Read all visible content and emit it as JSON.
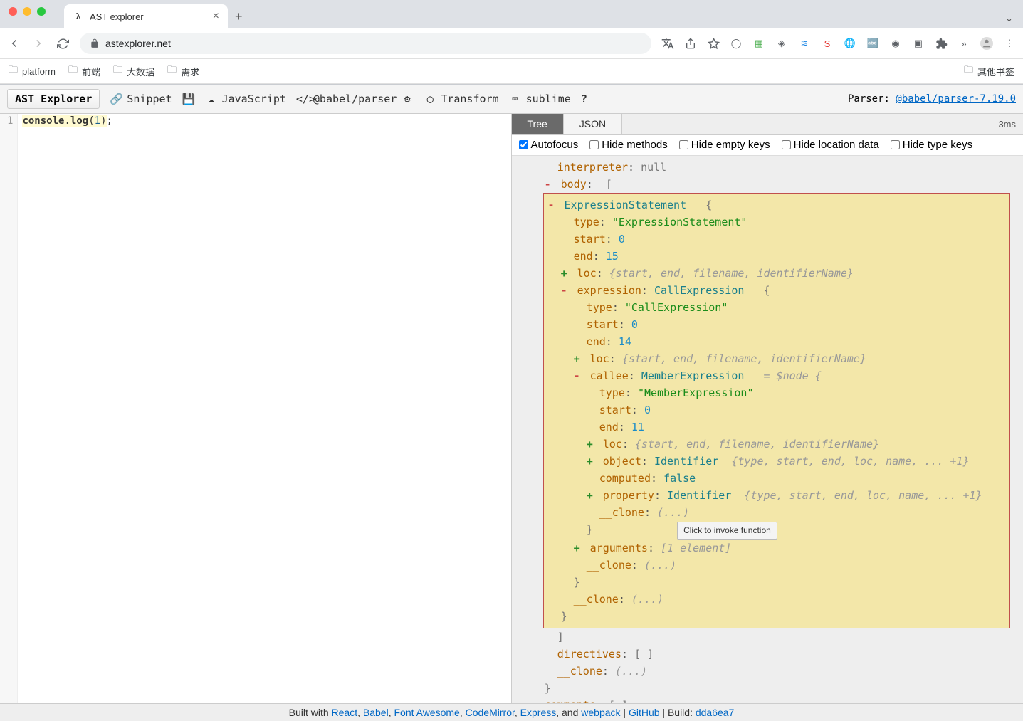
{
  "browser": {
    "tab_title": "AST explorer",
    "url": "astexplorer.net",
    "bookmarks": [
      "platform",
      "前端",
      "大数据",
      "需求"
    ],
    "other_bookmarks": "其他书签"
  },
  "toolbar": {
    "title": "AST Explorer",
    "snippet": "Snippet",
    "language": "JavaScript",
    "parser": "@babel/parser",
    "transform": "Transform",
    "keymap": "sublime",
    "help": "?",
    "parser_label": "Parser:",
    "parser_version": "@babel/parser-7.19.0"
  },
  "code": {
    "line_no": "1",
    "text_console": "console",
    "text_dot": ".",
    "text_log": "log",
    "text_open": "(",
    "text_arg": "1",
    "text_close": ")",
    "text_semi": ";"
  },
  "output": {
    "tabs": {
      "tree": "Tree",
      "json": "JSON"
    },
    "parse_time": "3ms",
    "filters": {
      "autofocus": "Autofocus",
      "hide_methods": "Hide methods",
      "hide_empty": "Hide empty keys",
      "hide_location": "Hide location data",
      "hide_type": "Hide type keys"
    }
  },
  "tree": {
    "interpreter_key": "interpreter",
    "interpreter_val": "null",
    "body_key": "body",
    "body_open": "[",
    "expr_stmt": "ExpressionStatement",
    "brace_open": "{",
    "brace_close": "}",
    "type_key": "type",
    "type_val1": "\"ExpressionStatement\"",
    "start_key": "start",
    "end_key": "end",
    "loc_key": "loc",
    "loc_summary": "{start, end, filename, identifierName}",
    "expression_key": "expression",
    "call_expr": "CallExpression",
    "type_val2": "\"CallExpression\"",
    "callee_key": "callee",
    "member_expr": "MemberExpression",
    "eq_node": "= $node {",
    "type_val3": "\"MemberExpression\"",
    "object_key": "object",
    "identifier": "Identifier",
    "obj_summary": "{type, start, end, loc, name, ... +1}",
    "computed_key": "computed",
    "computed_val": "false",
    "property_key": "property",
    "prop_summary": "{type, start, end, loc, name, ... +1}",
    "clone_key": "__clone",
    "clone_val": "(...)",
    "arguments_key": "arguments",
    "args_summary": "[1 element]",
    "directives_key": "directives",
    "directives_val": "[ ]",
    "comments_key": "comments",
    "comments_val": "[ ]",
    "tooltip": "Click to invoke function",
    "start0": "0",
    "end15": "15",
    "end14": "14",
    "end11": "11"
  },
  "footer": {
    "prefix": "Built with ",
    "react": "React",
    "babel": "Babel",
    "fa": "Font Awesome",
    "cm": "CodeMirror",
    "express": "Express",
    "and": ", and ",
    "webpack": "webpack",
    "sep": " | ",
    "github": "GitHub",
    "build_label": " | Build: ",
    "build": "dda6ea7"
  }
}
